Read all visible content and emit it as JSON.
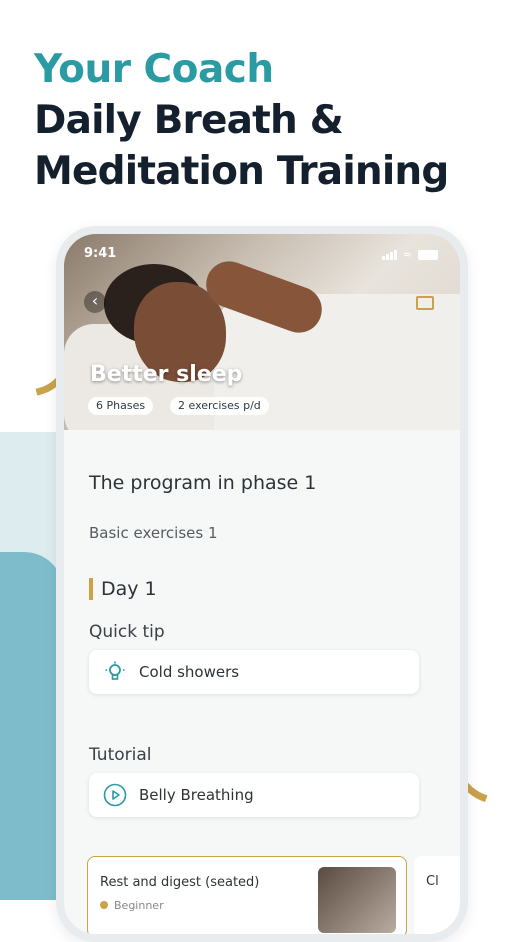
{
  "header": {
    "line1": "Your Coach",
    "line2": "Daily Breath &",
    "line3": "Meditation Training"
  },
  "phone": {
    "status_time": "9:41",
    "hero": {
      "title": "Better sleep",
      "chips": [
        "6 Phases",
        "2 exercises p/d"
      ]
    },
    "program": {
      "title": "The program in phase 1",
      "subtitle": "Basic exercises 1",
      "day_label": "Day 1",
      "quick_tip_label": "Quick tip",
      "quick_tip_item": "Cold showers",
      "tutorial_label": "Tutorial",
      "tutorial_item": "Belly Breathing"
    },
    "exercises": [
      {
        "title": "Rest and digest (seated)",
        "level": "Beginner"
      },
      {
        "title": "Cl"
      }
    ]
  },
  "colors": {
    "accent_teal": "#2a9aa3",
    "gold": "#c9a24a",
    "dark_text": "#15202e"
  }
}
